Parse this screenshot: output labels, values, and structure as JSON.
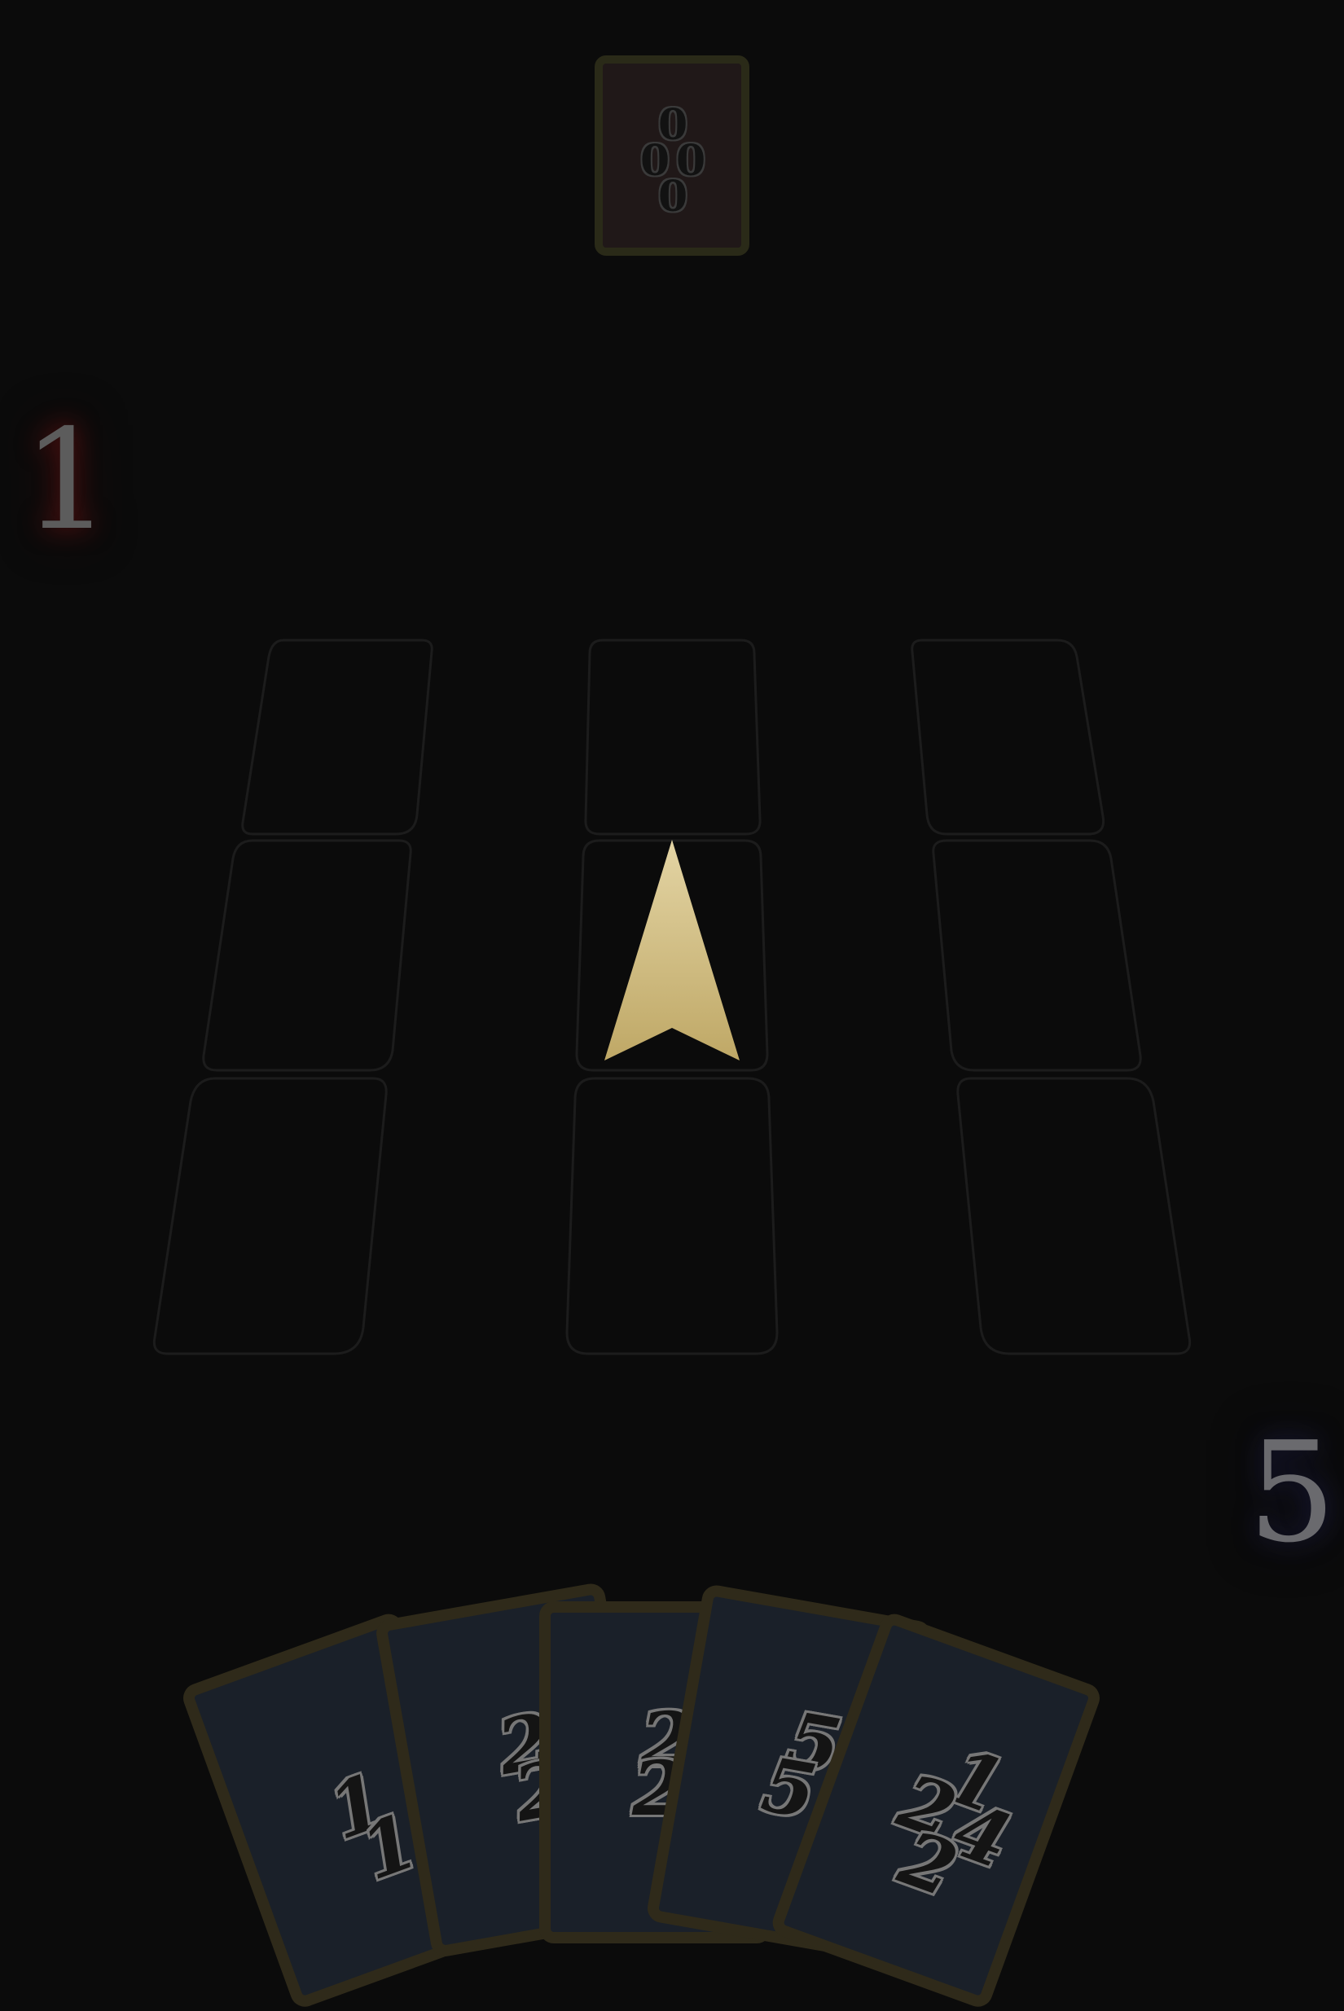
{
  "opponent_card": {
    "pips": [
      "0",
      "0",
      "0",
      "0"
    ]
  },
  "scores": {
    "opponent": "1",
    "player": "5"
  },
  "board": {
    "rows": 3,
    "columns": 3
  },
  "colors": {
    "background": "#0b0b0b",
    "slot_outline": "#1c1c1c",
    "card_border": "#2f2a1a",
    "hand_card_fill": "#1a2029",
    "opponent_card_fill": "#201818",
    "arrow_top": "#e3d4a4",
    "arrow_bottom": "#bfa866"
  },
  "hand": [
    {
      "pips": [
        "1",
        "1"
      ]
    },
    {
      "pips": [
        "2",
        "2"
      ]
    },
    {
      "pips": [
        "2",
        "2"
      ]
    },
    {
      "pips": [
        "5",
        "5"
      ]
    },
    {
      "pips": [
        "1",
        "2",
        "4",
        "2"
      ]
    }
  ],
  "turn_indicator": {
    "icon": "arrow-up-icon"
  }
}
